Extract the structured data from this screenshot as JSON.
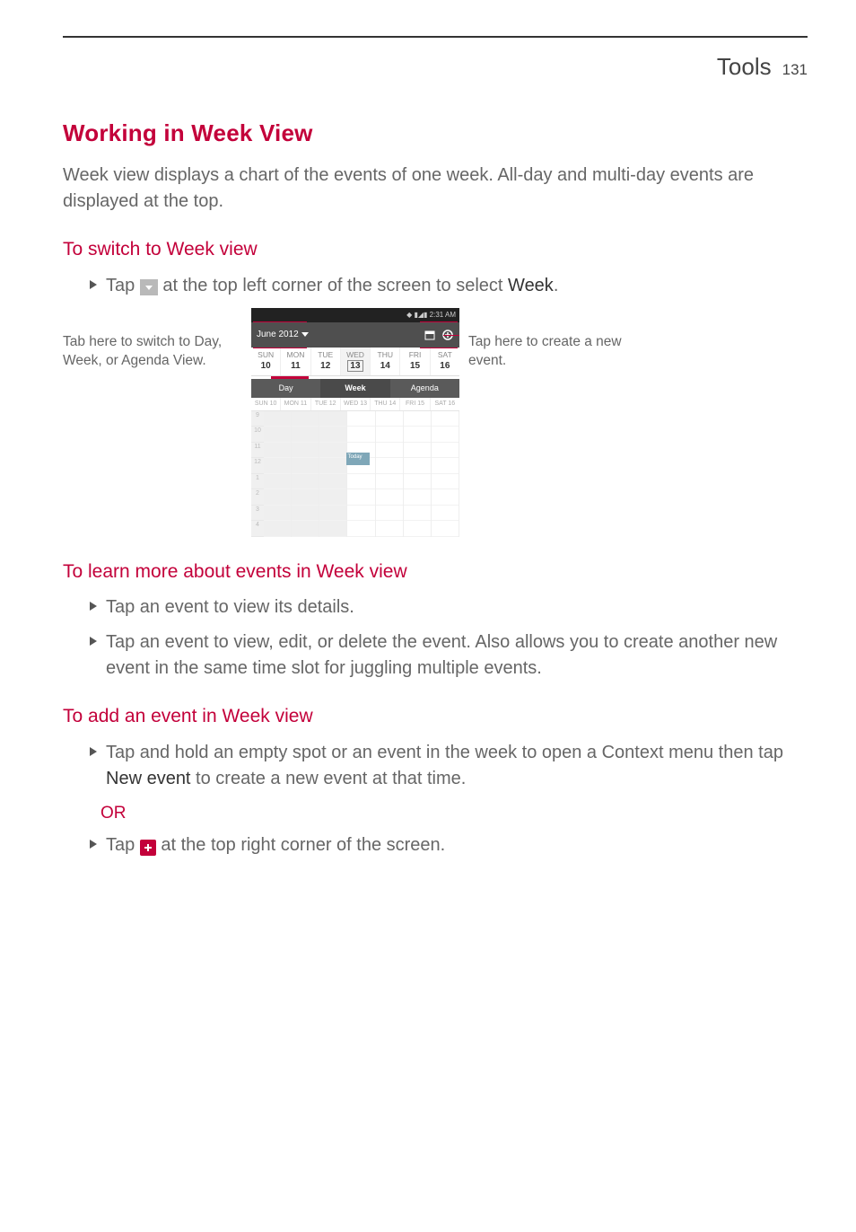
{
  "header": {
    "section": "Tools",
    "page": "131"
  },
  "h_working": "Working in Week View",
  "p_week_intro": "Week view displays a chart of the events of one week. All-day and multi-day events are displayed at the top.",
  "h_switch": "To switch to Week view",
  "switch_line_pre": "Tap ",
  "switch_line_mid": " at the top left corner of the screen to select ",
  "switch_line_bold": "Week",
  "switch_line_post": ".",
  "annot_left": "Tab here to switch to Day, Week, or Agenda View.",
  "annot_right": "Tap here to create a new event.",
  "phone": {
    "status_time": "2:31 AM",
    "month_label": "June 2012",
    "date_row": [
      {
        "dow": "SUN",
        "num": "10"
      },
      {
        "dow": "MON",
        "num": "11"
      },
      {
        "dow": "TUE",
        "num": "12"
      },
      {
        "dow": "WED",
        "num": "13",
        "today": true
      },
      {
        "dow": "THU",
        "num": "14"
      },
      {
        "dow": "FRI",
        "num": "15"
      },
      {
        "dow": "SAT",
        "num": "16"
      }
    ],
    "tabs": {
      "day": "Day",
      "week": "Week",
      "agenda": "Agenda"
    },
    "dayheads": [
      "SUN 10",
      "MON 11",
      "TUE 12",
      "WED 13",
      "THU 14",
      "FRI 15",
      "SAT 16"
    ],
    "hours": [
      "9",
      "10",
      "11",
      "12",
      "1",
      "2",
      "3",
      "4"
    ],
    "event_chip": "Today"
  },
  "h_learn": "To learn more about events in Week view",
  "learn_b1": "Tap an event to view its details.",
  "learn_b2": "Tap an event to view, edit, or delete the event. Also allows you to create another new event in the same time slot for juggling multiple events.",
  "h_add": "To add an event in Week view",
  "add_b1_pre": "Tap and hold an empty spot or an event in the week to open a Context menu then tap ",
  "add_b1_bold": "New event",
  "add_b1_post": " to create a new event at that time.",
  "or_label": "OR",
  "add_b2_pre": "Tap ",
  "add_b2_post": " at the top right corner of the screen."
}
